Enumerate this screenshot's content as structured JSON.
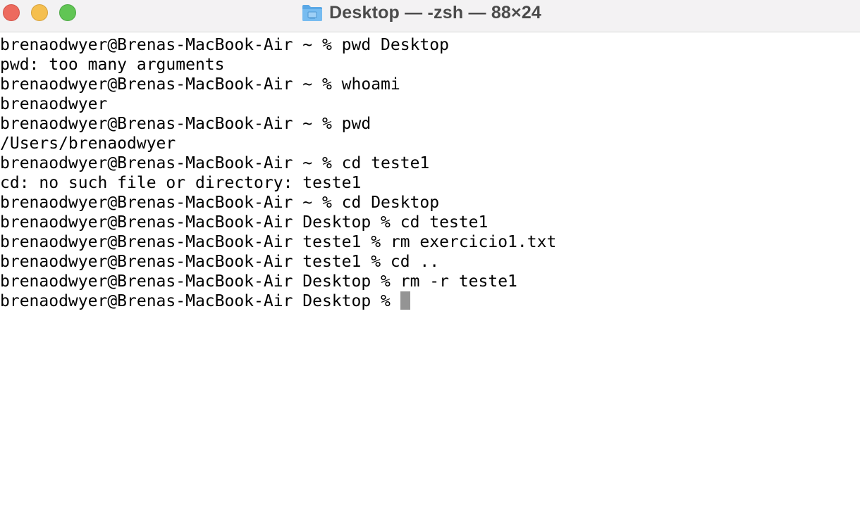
{
  "window": {
    "title": "Desktop — -zsh — 88×24",
    "title_icon": "folder-icon",
    "traffic_lights": {
      "close_color": "#ed6a5e",
      "minimize_color": "#f5bf4f",
      "zoom_color": "#61c554"
    }
  },
  "terminal": {
    "lines": [
      "brenaodwyer@Brenas-MacBook-Air ~ % pwd Desktop",
      "pwd: too many arguments",
      "brenaodwyer@Brenas-MacBook-Air ~ % whoami",
      "brenaodwyer",
      "brenaodwyer@Brenas-MacBook-Air ~ % pwd",
      "/Users/brenaodwyer",
      "brenaodwyer@Brenas-MacBook-Air ~ % cd teste1",
      "cd: no such file or directory: teste1",
      "brenaodwyer@Brenas-MacBook-Air ~ % cd Desktop",
      "brenaodwyer@Brenas-MacBook-Air Desktop % cd teste1",
      "brenaodwyer@Brenas-MacBook-Air teste1 % rm exercicio1.txt",
      "brenaodwyer@Brenas-MacBook-Air teste1 % cd ..",
      "brenaodwyer@Brenas-MacBook-Air Desktop % rm -r teste1"
    ],
    "prompt": "brenaodwyer@Brenas-MacBook-Air Desktop % ",
    "cursor_color": "#949494"
  }
}
